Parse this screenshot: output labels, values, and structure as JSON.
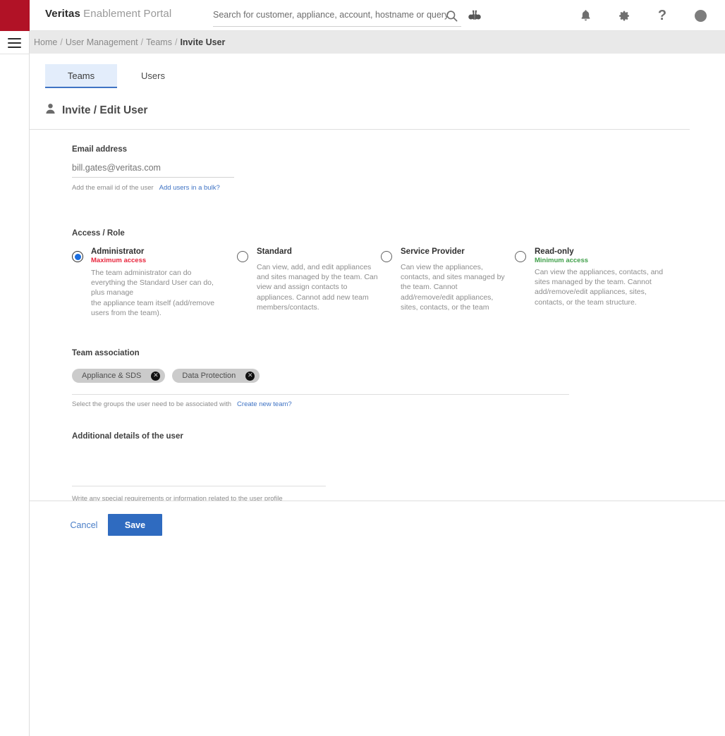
{
  "brand": {
    "bold": "Veritas",
    "rest": " Enablement Portal"
  },
  "search": {
    "placeholder": "Search for customer, appliance, account, hostname or query",
    "value": ""
  },
  "topbar_icons": [
    {
      "name": "search-icon"
    },
    {
      "name": "binoculars-icon"
    },
    {
      "name": "bell-icon"
    },
    {
      "name": "gear-icon"
    },
    {
      "name": "help-icon",
      "glyph": "?"
    },
    {
      "name": "avatar"
    }
  ],
  "breadcrumb": {
    "items": [
      "Home",
      "User Management",
      "Teams"
    ],
    "current": "Invite User",
    "separator": "/"
  },
  "tabs": [
    {
      "label": "Teams",
      "active": true
    },
    {
      "label": "Users",
      "active": false
    }
  ],
  "page": {
    "title": "Invite / Edit User",
    "icon": "user-icon"
  },
  "email": {
    "label": "Email address",
    "value": "bill.gates@veritas.com",
    "placeholder": "bill.gates@veritas.com",
    "helper": "Add the email id of the user",
    "link": "Add users in a bulk?"
  },
  "access": {
    "label": "Access / Role",
    "selected": 0,
    "roles": [
      {
        "name": "Administrator",
        "access_note": "Maximum access",
        "access_type": "max",
        "description": "The team administrator can do everything the Standard User can do, plus manage\nthe appliance team itself  (add/remove users from the team).",
        "selected": true
      },
      {
        "name": "Standard",
        "access_note": "",
        "access_type": "",
        "description": "Can view, add, and edit appliances  and sites managed by the team. Can view and assign contacts to appliances. Cannot add new team members/contacts.",
        "selected": false
      },
      {
        "name": "Service Provider",
        "access_note": "",
        "access_type": "",
        "description": "Can view the appliances, contacts, and sites managed by the team. Cannot add/remove/edit appliances, sites, contacts, or the team",
        "selected": false
      },
      {
        "name": "Read-only",
        "access_note": "Minimum access",
        "access_type": "min",
        "description": "Can view the appliances, contacts, and sites managed by the team. Cannot add/remove/edit appliances, sites, contacts, or the team structure.",
        "selected": false
      }
    ]
  },
  "team_association": {
    "label": "Team association",
    "chips": [
      {
        "label": "Appliance & SDS",
        "remove": "✕"
      },
      {
        "label": "Data Protection",
        "remove": "✕"
      }
    ],
    "helper": "Select the groups the user need to be associated with",
    "link": "Create new team?"
  },
  "additional": {
    "label": "Additional details of the user",
    "value": "",
    "placeholder": "",
    "helper": "Write any special requirements or information related to the user profile"
  },
  "footer": {
    "cancel_label": "Cancel",
    "save_label": "Save"
  },
  "colors": {
    "brand_red": "#b11226",
    "accent_blue": "#2f6bc0",
    "link_blue": "#3f73c4",
    "max_access_red": "#e8253c",
    "min_access_green": "#41a04b",
    "chip_gray": "#cbcbcb",
    "breadcrumb_bg": "#e9e9e9",
    "active_tab_bg": "#e3edfb"
  }
}
